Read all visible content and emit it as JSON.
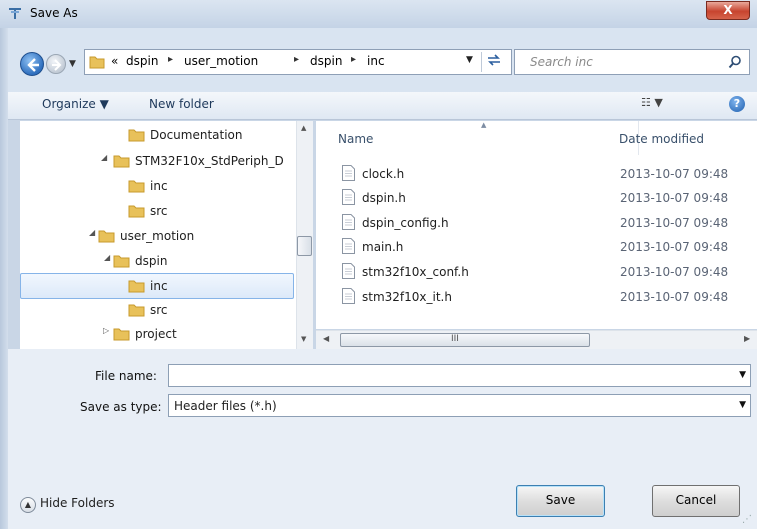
{
  "window": {
    "title": "Save As",
    "close_label": "X"
  },
  "address": {
    "overflow": "«",
    "crumbs": [
      "dspin",
      "user_motion",
      "dspin",
      "inc"
    ],
    "arrow": "▸"
  },
  "search": {
    "placeholder": "Search inc"
  },
  "toolbar": {
    "organize": "Organize ▼",
    "new_folder": "New folder",
    "views": "☷ ▼",
    "help": "?"
  },
  "tree": {
    "items": [
      {
        "label": "Documentation",
        "toggle": "",
        "selected": false
      },
      {
        "label": "STM32F10x_StdPeriph_D",
        "toggle": "◢",
        "selected": false
      },
      {
        "label": "inc",
        "toggle": "",
        "selected": false
      },
      {
        "label": "src",
        "toggle": "",
        "selected": false
      },
      {
        "label": "user_motion",
        "toggle": "◢",
        "selected": false
      },
      {
        "label": "dspin",
        "toggle": "◢",
        "selected": false
      },
      {
        "label": "inc",
        "toggle": "",
        "selected": true
      },
      {
        "label": "src",
        "toggle": "",
        "selected": false
      },
      {
        "label": "project",
        "toggle": "▷",
        "selected": false
      }
    ]
  },
  "files": {
    "col_name": "Name",
    "col_date": "Date modified",
    "rows": [
      {
        "name": "clock.h",
        "date": "2013-10-07 09:48"
      },
      {
        "name": "dspin.h",
        "date": "2013-10-07 09:48"
      },
      {
        "name": "dspin_config.h",
        "date": "2013-10-07 09:48"
      },
      {
        "name": "main.h",
        "date": "2013-10-07 09:48"
      },
      {
        "name": "stm32f10x_conf.h",
        "date": "2013-10-07 09:48"
      },
      {
        "name": "stm32f10x_it.h",
        "date": "2013-10-07 09:48"
      }
    ],
    "scroll_label": "III"
  },
  "form": {
    "file_name_label": "File name:",
    "file_name_value": "",
    "save_type_label": "Save as type:",
    "save_type_value": "Header files (*.h)"
  },
  "footer": {
    "hide_folders": "Hide Folders",
    "save": "Save",
    "cancel": "Cancel"
  },
  "colors": {
    "accent": "#1e395b",
    "selection": "#dce9f9"
  }
}
